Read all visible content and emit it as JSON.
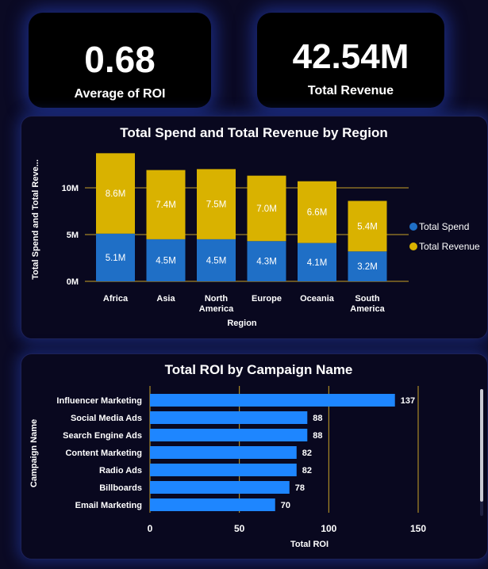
{
  "kpis": {
    "roi": {
      "value": "0.68",
      "label": "Average of ROI"
    },
    "revenue": {
      "value": "42.54M",
      "label": "Total Revenue"
    }
  },
  "colors": {
    "spend": "#1f6fc6",
    "revenue": "#d9b200",
    "roi_bar": "#1e86ff",
    "gridline": "#c9a227"
  },
  "chart_data": [
    {
      "type": "bar",
      "stacked": true,
      "title": "Total Spend and Total Revenue by Region",
      "xlabel": "Region",
      "ylabel": "Total Spend and Total Reve...",
      "categories": [
        [
          "Africa"
        ],
        [
          "Asia"
        ],
        [
          "North",
          "America"
        ],
        [
          "Europe"
        ],
        [
          "Oceania"
        ],
        [
          "South",
          "America"
        ]
      ],
      "series": [
        {
          "name": "Total Spend",
          "values": [
            5.1,
            4.5,
            4.5,
            4.3,
            4.1,
            3.2
          ],
          "labels": [
            "5.1M",
            "4.5M",
            "4.5M",
            "4.3M",
            "4.1M",
            "3.2M"
          ]
        },
        {
          "name": "Total Revenue",
          "values": [
            8.6,
            7.4,
            7.5,
            7.0,
            6.6,
            5.4
          ],
          "labels": [
            "8.6M",
            "7.4M",
            "7.5M",
            "7.0M",
            "6.6M",
            "5.4M"
          ]
        }
      ],
      "yticks": [
        0,
        5,
        10
      ],
      "ytick_labels": [
        "0M",
        "5M",
        "10M"
      ],
      "ylim": [
        0,
        13.7
      ],
      "legend": "right",
      "grid": true
    },
    {
      "type": "bar",
      "orientation": "horizontal",
      "title": "Total ROI by Campaign Name",
      "xlabel": "Total ROI",
      "ylabel": "Campaign Name",
      "categories": [
        "Influencer Marketing",
        "Social Media Ads",
        "Search Engine Ads",
        "Content Marketing",
        "Radio Ads",
        "Billboards",
        "Email Marketing"
      ],
      "values": [
        137,
        88,
        88,
        82,
        82,
        78,
        70
      ],
      "value_labels": [
        "137",
        "88",
        "88",
        "82",
        "82",
        "78",
        "70"
      ],
      "xticks": [
        0,
        50,
        100,
        150
      ],
      "xtick_labels": [
        "0",
        "50",
        "100",
        "150"
      ],
      "xlim": [
        0,
        150
      ],
      "grid": true
    }
  ]
}
